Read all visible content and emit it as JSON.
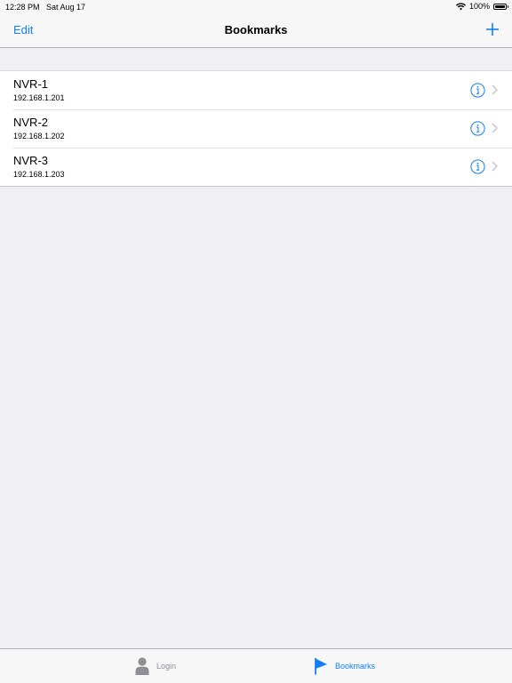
{
  "status_bar": {
    "time": "12:28 PM",
    "date": "Sat Aug 17",
    "battery": "100%"
  },
  "nav": {
    "left_button": "Edit",
    "title": "Bookmarks",
    "right_icon": "plus-icon"
  },
  "bookmarks": [
    {
      "name": "NVR-1",
      "address": "192.168.1.201"
    },
    {
      "name": "NVR-2",
      "address": "192.168.1.202"
    },
    {
      "name": "NVR-3",
      "address": "192.168.1.203"
    }
  ],
  "tabs": [
    {
      "label": "Login",
      "icon": "person-icon",
      "selected": false
    },
    {
      "label": "Bookmarks",
      "icon": "flag-icon",
      "selected": true
    }
  ],
  "colors": {
    "accent": "#147efb",
    "background": "#efeff4",
    "bar": "#f7f7f7",
    "inactive": "#8e8e93"
  }
}
